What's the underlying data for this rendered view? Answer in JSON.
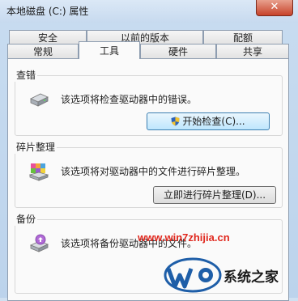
{
  "window": {
    "title": "本地磁盘 (C:) 属性",
    "close_glyph": "✕"
  },
  "tabs": {
    "row1": [
      "安全",
      "以前的版本",
      "配额"
    ],
    "row2": [
      "常规",
      "工具",
      "硬件",
      "共享"
    ],
    "active": "工具"
  },
  "groups": {
    "check": {
      "title": "查错",
      "description": "该选项将检查驱动器中的错误。",
      "button_label": "开始检查(C)...",
      "icon": "disk-check-icon"
    },
    "defrag": {
      "title": "碎片整理",
      "description": "该选项将对驱动器中的文件进行碎片整理。",
      "button_label": "立即进行碎片整理(D)...",
      "icon": "defrag-icon"
    },
    "backup": {
      "title": "备份",
      "description": "该选项将备份驱动器中的文件。",
      "icon": "backup-icon"
    }
  },
  "watermark": {
    "url": "www.win7zhijia.cn",
    "brand": "系统之家"
  },
  "colors": {
    "accent": "#3c7fb1",
    "watermark_red": "#e0281e",
    "close_red": "#c7432a"
  }
}
